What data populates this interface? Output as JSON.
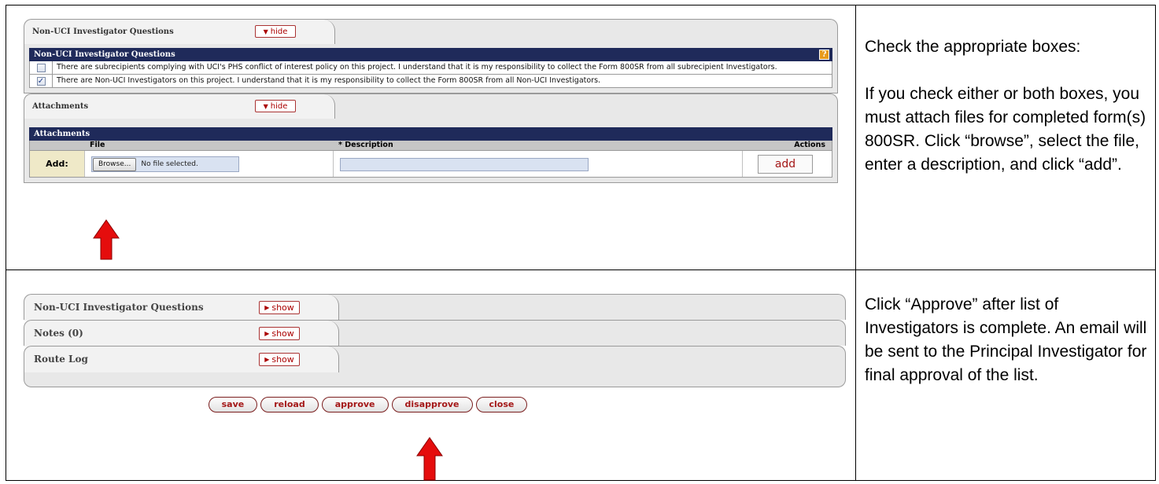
{
  "panel1": {
    "tab_title": "Non-UCI Investigator Questions",
    "toggle": "hide",
    "header": "Non-UCI Investigator Questions",
    "help_glyph": "?",
    "questions": [
      {
        "checked": false,
        "text": "There are subrecipients complying with UCI's PHS conflict of interest policy on this project. I understand that it is my responsibility to collect the Form 800SR from all subrecipient Investigators."
      },
      {
        "checked": true,
        "text": "There are Non-UCI Investigators on this project. I understand that it is my responsibility to collect the Form 800SR from all Non-UCI Investigators."
      }
    ]
  },
  "attachments": {
    "tab_title": "Attachments",
    "toggle": "hide",
    "header": "Attachments",
    "columns": {
      "file": "File",
      "description": "* Description",
      "actions": "Actions"
    },
    "row_label": "Add:",
    "browse_label": "Browse...",
    "no_file": "No file selected.",
    "add_label": "add"
  },
  "instructions1": {
    "line1": "Check the appropriate boxes:",
    "line2": "If you check either or both boxes, you must attach files for completed form(s) 800SR. Click “browse”, select the file, enter a description, and click “add”."
  },
  "collapsed_tabs": [
    {
      "title": "Non-UCI Investigator Questions",
      "toggle": "show"
    },
    {
      "title": "Notes (0)",
      "toggle": "show"
    },
    {
      "title": "Route Log",
      "toggle": "show"
    }
  ],
  "buttons": [
    "save",
    "reload",
    "approve",
    "disapprove",
    "close"
  ],
  "instructions2": "Click “Approve” after list of Investigators is complete.  An email will be sent to the Principal Investigator for final approval of the list.",
  "colors": {
    "navy_header": "#1f2a5a",
    "accent_red": "#a41818",
    "arrow_red": "#e50d0d"
  }
}
